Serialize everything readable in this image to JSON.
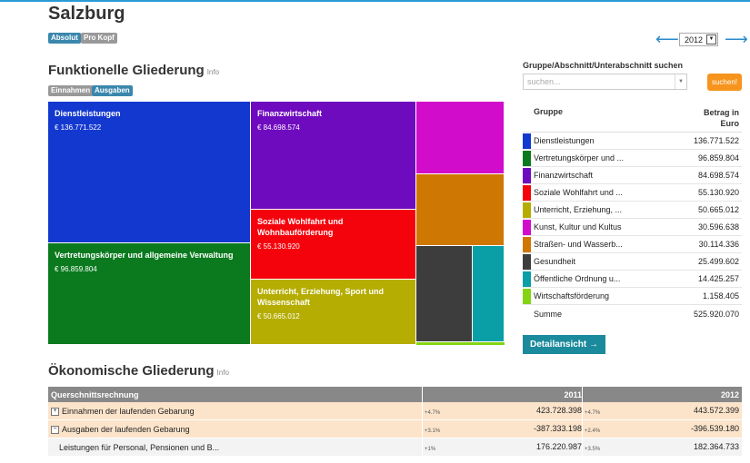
{
  "page_title": "Salzburg",
  "view_badges": [
    "Absolut",
    "Pro Kopf"
  ],
  "year": {
    "selected": "2012",
    "prev_arrow": "⟵",
    "next_arrow": "⟶"
  },
  "functional": {
    "heading": "Funktionelle Gliederung",
    "info": "Info",
    "badges": [
      "Einnahmen",
      "Ausgaben"
    ],
    "tiles": [
      {
        "label": "Dienstleistungen",
        "value": "€ 136.771.522",
        "color": "#1338d0"
      },
      {
        "label": "Vertretungskörper und allgemeine Verwaltung",
        "value": "€ 96.859.804",
        "color": "#0b7a1f"
      },
      {
        "label": "Finanzwirtschaft",
        "value": "€ 84.698.574",
        "color": "#6f0bbf"
      },
      {
        "label": "Soziale Wohlfahrt und Wohnbauförderung",
        "value": "€ 55.130.920",
        "color": "#f5030c"
      },
      {
        "label": "Unterricht, Erziehung, Sport und Wissenschaft",
        "value": "€ 50.665.012",
        "color": "#b5ad02"
      },
      {
        "label": "",
        "value": "",
        "color": "#d10ccb"
      },
      {
        "label": "",
        "value": "",
        "color": "#cf7703"
      },
      {
        "label": "",
        "value": "",
        "color": "#3d3d3d"
      },
      {
        "label": "",
        "value": "",
        "color": "#0a9ea6"
      },
      {
        "label": "",
        "value": "",
        "color": "#84d414"
      }
    ]
  },
  "search": {
    "label": "Gruppe/Abschnitt/Unterabschnitt suchen",
    "placeholder": "suchen...",
    "button": "suchen!"
  },
  "group_table": {
    "col_group": "Gruppe",
    "col_amount_line1": "Betrag in",
    "col_amount_line2": "Euro",
    "rows": [
      {
        "name": "Dienstleistungen",
        "value": "136.771.522",
        "color": "#1338d0"
      },
      {
        "name": "Vertretungskörper und ...",
        "value": "96.859.804",
        "color": "#0b7a1f"
      },
      {
        "name": "Finanzwirtschaft",
        "value": "84.698.574",
        "color": "#6f0bbf"
      },
      {
        "name": "Soziale Wohlfahrt und ...",
        "value": "55.130.920",
        "color": "#f5030c"
      },
      {
        "name": "Unterricht, Erziehung, ...",
        "value": "50.665.012",
        "color": "#b5ad02"
      },
      {
        "name": "Kunst, Kultur und Kultus",
        "value": "30.596.638",
        "color": "#d10ccb"
      },
      {
        "name": "Straßen- und Wasserb...",
        "value": "30.114.336",
        "color": "#cf7703"
      },
      {
        "name": "Gesundheit",
        "value": "25.499.602",
        "color": "#3d3d3d"
      },
      {
        "name": "Öffentliche Ordnung u...",
        "value": "14.425.257",
        "color": "#0a9ea6"
      },
      {
        "name": "Wirtschaftsförderung",
        "value": "1.158.405",
        "color": "#84d414"
      }
    ],
    "sum_label": "Summe",
    "sum_value": "525.920.070",
    "detail_button": "Detailansicht →"
  },
  "economic": {
    "heading": "Ökonomische Gliederung",
    "info": "Info",
    "col_label": "Querschnittsrechnung",
    "col_year1": "2011",
    "col_year2": "2012",
    "rows": [
      {
        "label": "Einnahmen der laufenden Gebarung",
        "toggle": "+",
        "pct1": "+4.7%",
        "v1": "423.728.398",
        "pct2": "+4.7%",
        "v2": "443.572.399"
      },
      {
        "label": "Ausgaben der laufenden Gebarung",
        "toggle": "−",
        "pct1": "+3.1%",
        "v1": "-387.333.198",
        "pct2": "+2.4%",
        "v2": "-396.539.180"
      },
      {
        "label": "Leistungen für Personal, Pensionen und B...",
        "toggle": "",
        "pct1": "+1%",
        "v1": "176.220.987",
        "pct2": "+3.5%",
        "v2": "182.364.733"
      }
    ]
  }
}
